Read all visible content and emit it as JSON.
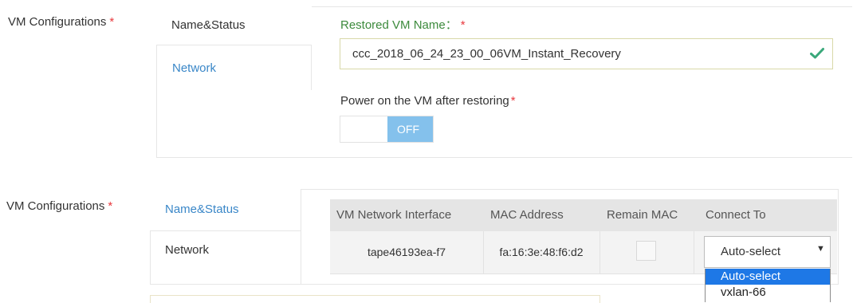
{
  "section1": {
    "label": "VM Configurations",
    "required_mark": "*",
    "tabs": [
      {
        "label": "Name&Status",
        "active": true
      },
      {
        "label": "Network",
        "active": false
      }
    ],
    "restored_name_label": "Restored VM Name：",
    "restored_name_value": "ccc_2018_06_24_23_00_06VM_Instant_Recovery",
    "power_label": "Power on the VM after restoring",
    "power_toggle": "OFF",
    "check_icon": "check-icon"
  },
  "section2": {
    "label": "VM Configurations",
    "required_mark": "*",
    "tabs": [
      {
        "label": "Name&Status",
        "active": false
      },
      {
        "label": "Network",
        "active": true
      }
    ],
    "table": {
      "headers": [
        "VM Network Interface",
        "MAC Address",
        "Remain MAC",
        "Connect To"
      ],
      "rows": [
        {
          "interface": "tape46193ea-f7",
          "mac": "fa:16:3e:48:f6:d2",
          "remain_mac": false,
          "connect_to": "Auto-select"
        }
      ]
    },
    "dropdown_options": [
      "Auto-select",
      "vxlan-66"
    ]
  },
  "colors": {
    "accent_blue": "#3a87c8",
    "label_green": "#3c8a3c",
    "required_red": "#e8383d",
    "toggle_off": "#84c1ec",
    "selected_option": "#1e78e6"
  }
}
